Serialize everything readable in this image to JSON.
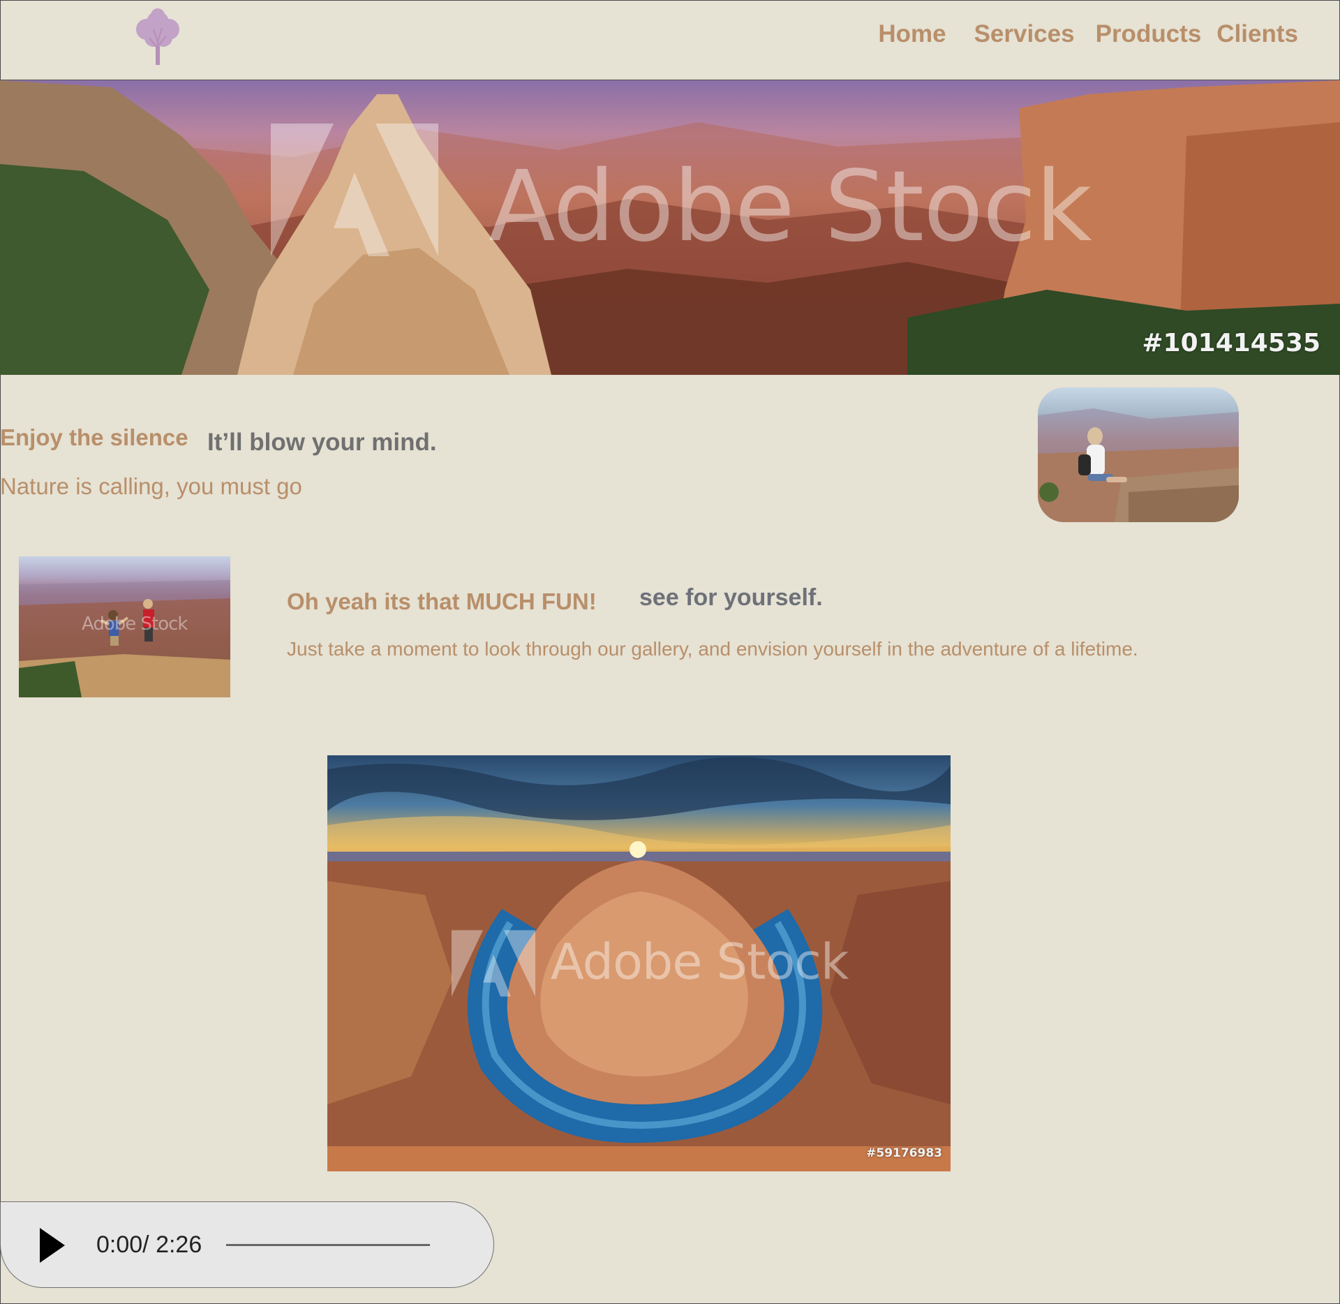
{
  "nav": {
    "logo_icon": "tree-icon",
    "items": [
      {
        "label": "Home"
      },
      {
        "label": "Services"
      },
      {
        "label": "Products"
      },
      {
        "label": "Clients"
      }
    ]
  },
  "hero": {
    "watermark": "Adobe Stock",
    "image_id": "#101414535"
  },
  "section1": {
    "title": "Enjoy the silence",
    "subtitle": "It’ll blow your mind.",
    "body": "Nature is calling, you must go"
  },
  "section2": {
    "title": "Oh yeah its that MUCH FUN!",
    "subtitle": "see for yourself.",
    "body": "Just take a moment to look through our gallery, and envision yourself in the adventure of a lifetime."
  },
  "gallery": {
    "thumb_watermark": "Adobe Stock",
    "big_watermark": "Adobe Stock",
    "big_image_id": "#59176983"
  },
  "audio": {
    "time": "0:00/ 2:26",
    "play_icon": "play-icon",
    "progress": 0
  },
  "colors": {
    "background": "#e6e2d4",
    "accent": "#b88f6a",
    "heading_gray": "#707070"
  }
}
